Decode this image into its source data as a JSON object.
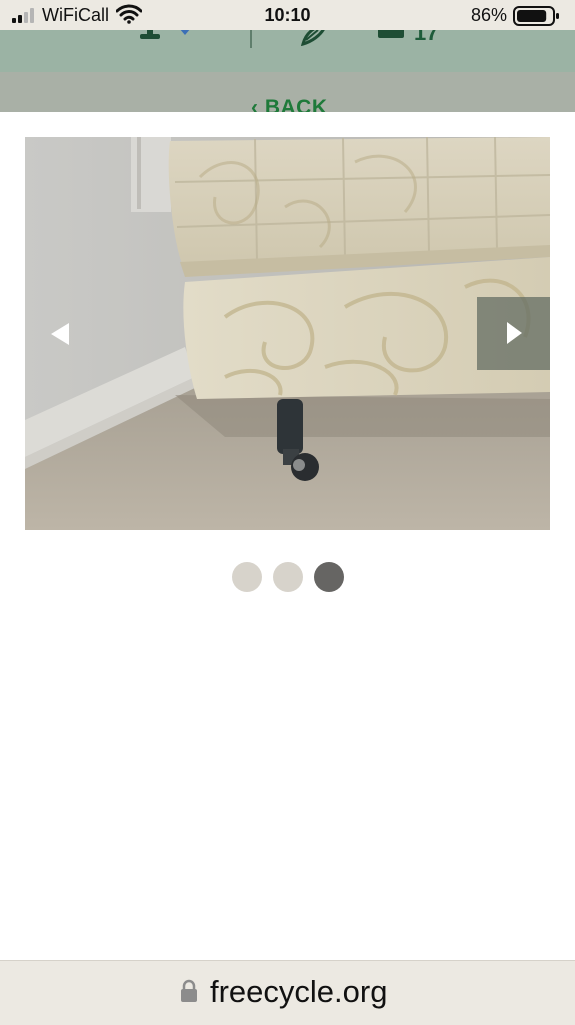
{
  "status_bar": {
    "carrier": "WiFiCall",
    "time": "10:10",
    "battery_percent": "86%",
    "battery_level": 0.86,
    "signal_bars_active": 2,
    "icons": [
      "signal-icon",
      "wifi-icon",
      "battery-icon"
    ]
  },
  "header": {
    "nav_icons": [
      "user-icon",
      "dropdown-caret-icon",
      "leaf-icon",
      "mail-icon"
    ],
    "message_count": "17",
    "back_label": "‹ BACK"
  },
  "gallery": {
    "photo_alt": "Divan bed base with mattress",
    "slide_count": 3,
    "active_index": 2,
    "prev_icon": "chevron-left-icon",
    "next_icon": "chevron-right-icon"
  },
  "browser": {
    "url": "freecycle.org",
    "secure_icon": "lock-icon"
  },
  "colors": {
    "header_green": "#9bb3a4",
    "link_green": "#1f7a3a",
    "dot_inactive": "#d7d3cb",
    "dot_active": "#666563"
  }
}
